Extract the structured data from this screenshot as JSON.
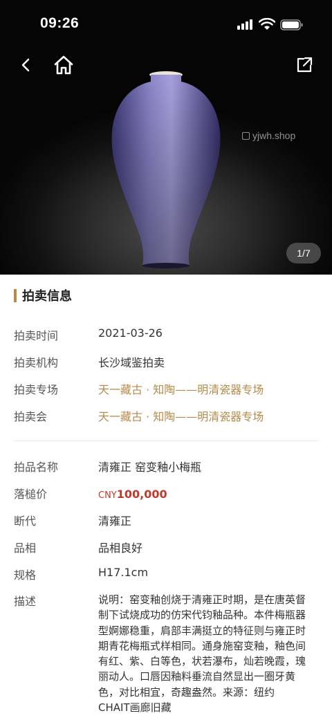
{
  "status_bar": {
    "time": "09:26"
  },
  "gallery": {
    "watermark": "yjwh.shop",
    "pager": "1/7"
  },
  "section": {
    "title": "拍卖信息"
  },
  "auction_info": {
    "time_label": "拍卖时间",
    "time_value": "2021-03-26",
    "org_label": "拍卖机构",
    "org_value": "长沙域鉴拍卖",
    "session_label": "拍卖专场",
    "session_value": "天一藏古 · 知陶——明清瓷器专场",
    "sale_label": "拍卖会",
    "sale_value": "天一藏古 · 知陶——明清瓷器专场"
  },
  "lot_info": {
    "name_label": "拍品名称",
    "name_value": "清雍正 窑变釉小梅瓶",
    "price_label": "落槌价",
    "price_currency": "CNY",
    "price_value": "100,000",
    "era_label": "断代",
    "era_value": "清雍正",
    "condition_label": "品相",
    "condition_value": "品相良好",
    "size_label": "规格",
    "size_value": "H17.1cm",
    "desc_label": "描述",
    "desc_value": "说明：窑变釉创烧于清雍正时期，是在唐英督制下试烧成功的仿宋代钧釉品种。本件梅瓶器型婀娜稳重，肩部丰满挺立的特征则与雍正时期青花梅瓶式样相同。通身施窑变釉，釉色间有红、紫、白等色，状若瀑布，灿若晚霞，瑰丽动人。口唇因釉料垂流自然显出一圈牙黄色，对比相宜，奇趣盎然。来源：纽约CHAIT画廊旧藏"
  },
  "colors": {
    "accent_gold": "#b68a4a",
    "price_red": "#c0392b"
  },
  "icons": [
    "back-icon",
    "home-icon",
    "share-icon",
    "signal-icon",
    "wifi-icon",
    "battery-icon"
  ]
}
